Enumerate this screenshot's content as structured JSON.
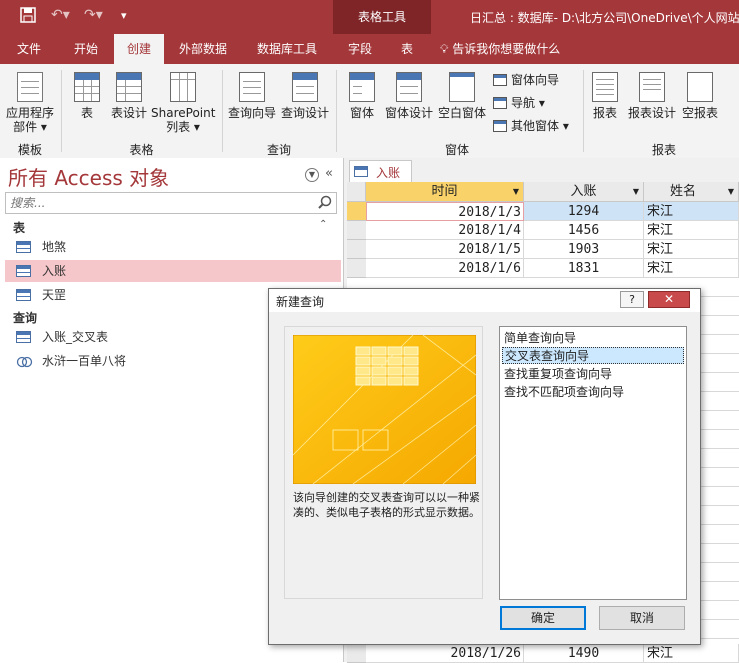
{
  "window": {
    "context_tab_title": "表格工具",
    "document_title": "日汇总 : 数据库- D:\\北方公司\\OneDrive\\个人网站"
  },
  "ribbon_tabs": [
    "文件",
    "开始",
    "创建",
    "外部数据",
    "数据库工具",
    "字段",
    "表"
  ],
  "tell_me": "告诉我你想要做什么",
  "ribbon": {
    "groups": {
      "template": "模板",
      "tables": "表格",
      "queries": "查询",
      "forms": "窗体",
      "reports": "报表"
    },
    "buttons": {
      "app_parts_line1": "应用程序",
      "app_parts_line2": "部件 ▾",
      "table": "表",
      "table_design": "表设计",
      "sharepoint_line1": "SharePoint",
      "sharepoint_line2": "列表 ▾",
      "query_wizard": "查询向导",
      "query_design": "查询设计",
      "form": "窗体",
      "form_design": "窗体设计",
      "blank_form": "空白窗体",
      "form_wizard": "窗体向导",
      "navigation": "导航 ▾",
      "more_forms": "其他窗体 ▾",
      "report": "报表",
      "report_design": "报表设计",
      "blank_report": "空报表"
    }
  },
  "nav_pane": {
    "title": "所有 Access 对象",
    "search_placeholder": "搜索...",
    "sections": {
      "tables": "表",
      "queries": "查询"
    },
    "tables": [
      "地煞",
      "入账",
      "天罡"
    ],
    "queries": [
      "入账_交叉表",
      "水浒一百单八将"
    ]
  },
  "datasheet": {
    "tab_label": "入账",
    "columns": [
      "时间",
      "入账",
      "姓名"
    ],
    "rows": [
      [
        "2018/1/3",
        "1294",
        "宋江"
      ],
      [
        "2018/1/4",
        "1456",
        "宋江"
      ],
      [
        "2018/1/5",
        "1903",
        "宋江"
      ],
      [
        "2018/1/6",
        "1831",
        "宋江"
      ]
    ],
    "bottom_row": [
      "2018/1/26",
      "1490",
      "宋江"
    ]
  },
  "dialog": {
    "title": "新建查询",
    "help": "?",
    "close": "✕",
    "wizards": [
      "简单查询向导",
      "交叉表查询向导",
      "查找重复项查询向导",
      "查找不匹配项查询向导"
    ],
    "selected_index": 1,
    "description": "该向导创建的交叉表查询可以以一种紧凑的、类似电子表格的形式显示数据。",
    "ok": "确定",
    "cancel": "取消"
  },
  "colors": {
    "accent": "#a4373a",
    "selection": "#f6c7ca",
    "header_highlight": "#f9d36a"
  }
}
